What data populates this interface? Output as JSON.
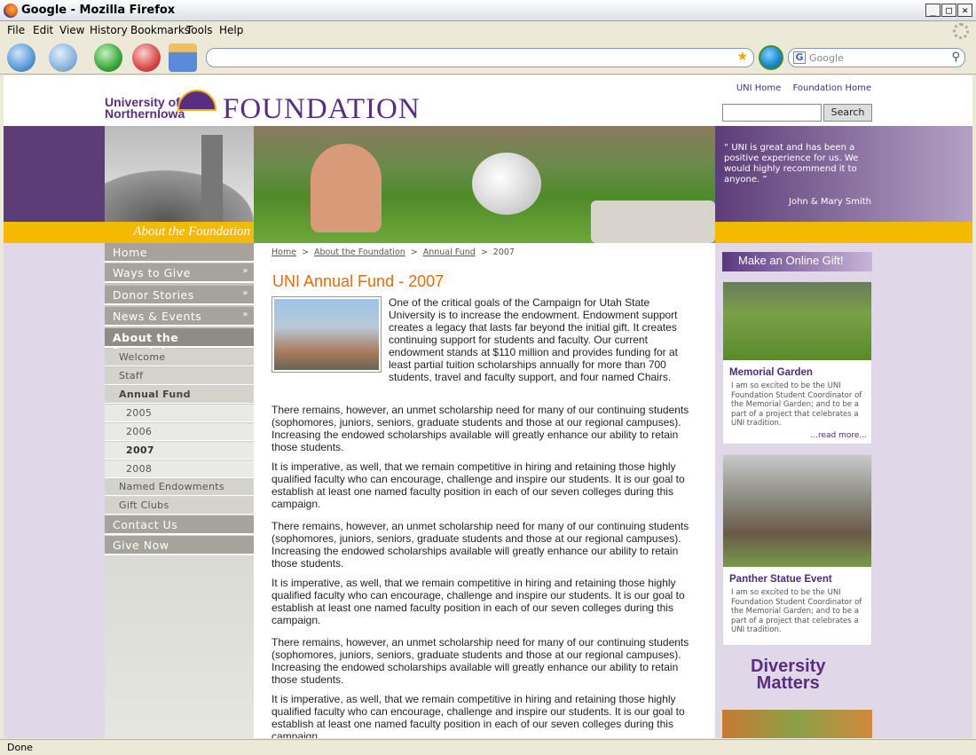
{
  "window": {
    "title": "Google - Mozilla Firefox"
  },
  "menu": [
    "File",
    "Edit",
    "View",
    "History",
    "Bookmarks",
    "Tools",
    "Help"
  ],
  "search_engine": {
    "placeholder": "Google"
  },
  "status": "Done",
  "header": {
    "logo_line1": "University of",
    "logo_line2": "NorthernIowa",
    "logo_found": "FOUNDATION",
    "links": [
      "UNI Home",
      "Foundation Home"
    ],
    "search_button": "Search"
  },
  "banner": {
    "section_label": "About the Foundation",
    "quote": "UNI is great and has been a positive experience for us. We would highly recommend it to anyone.",
    "quote_author": "John & Mary Smith",
    "colors": {
      "purple": "#5d3d78",
      "gold": "#f5b900",
      "title_orange": "#e96a0c"
    }
  },
  "nav": {
    "items": [
      {
        "label": "Home",
        "level": 1
      },
      {
        "label": "Ways to Give",
        "level": 1,
        "arrow": "»"
      },
      {
        "label": "Donor Stories",
        "level": 1,
        "arrow": "»"
      },
      {
        "label": "News & Events",
        "level": 1,
        "arrow": "»"
      },
      {
        "label": "About the Foundation",
        "level": 1
      },
      {
        "label": "Welcome",
        "level": 2
      },
      {
        "label": "Staff",
        "level": 2
      },
      {
        "label": "Annual Fund",
        "level": 2
      },
      {
        "label": "2005",
        "level": 3
      },
      {
        "label": "2006",
        "level": 3
      },
      {
        "label": "2007",
        "level": 3
      },
      {
        "label": "2008",
        "level": 3
      },
      {
        "label": "Named Endowments",
        "level": 2
      },
      {
        "label": "Gift Clubs",
        "level": 2
      },
      {
        "label": "Contact Us",
        "level": 1
      },
      {
        "label": "Give Now",
        "level": 1
      }
    ]
  },
  "breadcrumb": [
    "Home",
    "About the Foundation",
    "Annual Fund",
    "2007"
  ],
  "breadcrumb_sep": ">",
  "content": {
    "title": "UNI Annual Fund - 2007",
    "paragraphs": [
      "One of the critical goals of the Campaign for Utah State University is to increase the endowment. Endowment support creates a legacy that lasts far beyond the initial gift. It creates continuing support for students and faculty. Our current endowment stands at $110 million and provides funding for at least partial tuition scholarships annually for more than 700 students, travel and faculty support, and four named Chairs.",
      "There remains, however, an unmet scholarship need for many of our continuing students (sophomores, juniors, seniors, graduate students and those at our regional campuses). Increasing the endowed scholarships available will greatly enhance our ability to retain those students.",
      "It is imperative, as well, that we remain competitive in hiring and retaining those highly qualified faculty who can encourage, challenge and inspire our students. It is our goal to establish at least one named faculty position in each of our seven colleges during this campaign.",
      "There remains, however, an unmet scholarship need for many of our continuing students (sophomores, juniors, seniors, graduate students and those at our regional campuses). Increasing the endowed scholarships available will greatly enhance our ability to retain those students.",
      "It is imperative, as well, that we remain competitive in hiring and retaining those highly qualified faculty who can encourage, challenge and inspire our students. It is our goal to establish at least one named faculty position in each of our seven colleges during this campaign.",
      "There remains, however, an unmet scholarship need for many of our continuing students (sophomores, juniors, seniors, graduate students and those at our regional campuses). Increasing the endowed scholarships available will greatly enhance our ability to retain those students.",
      "It is imperative, as well, that we remain competitive in hiring and retaining those highly qualified faculty who can encourage, challenge and inspire our students. It is our goal to establish at least one named faculty position in each of our seven colleges during this campaign."
    ]
  },
  "right": {
    "gift_button": "Make an Online Gift!",
    "card1": {
      "title": "Memorial Garden",
      "text": "I am so excited to be the UNI Foundation Student Coordinator of the Memorial Garden; and to be a part of a project that celebrates a UNI tradition.",
      "more": "...read more..."
    },
    "card2": {
      "title": "Panther Statue Event",
      "text": "I am so excited to be the UNI Foundation Student Coordinator of the Memorial Garden; and to be a part of a project that celebrates a UNI tradition."
    },
    "diversity_line1": "Diversity",
    "diversity_line2": "Matters"
  }
}
